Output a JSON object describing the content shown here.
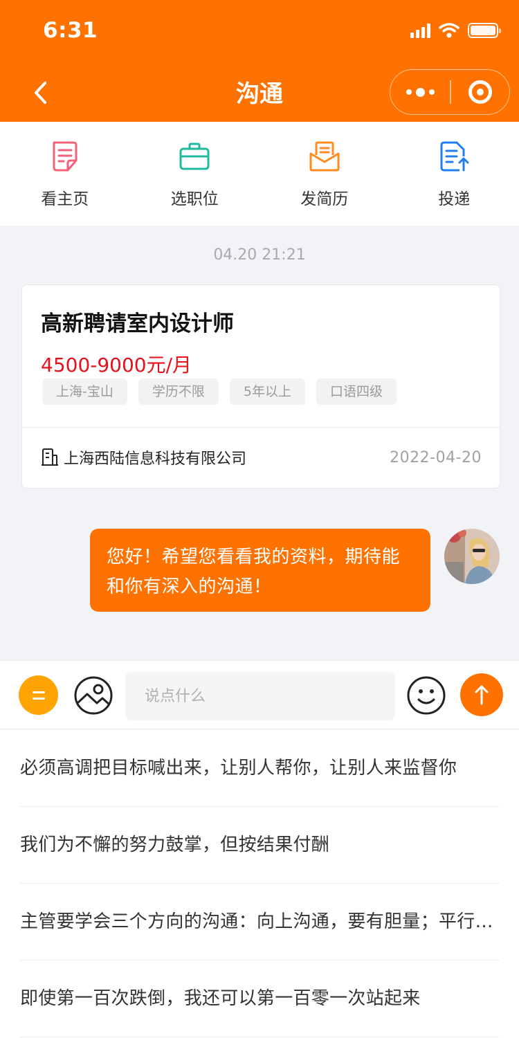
{
  "status_bar": {
    "time": "6:31"
  },
  "nav": {
    "title": "沟通"
  },
  "quick_actions": [
    {
      "label": "看主页",
      "icon": "resume-doc-icon"
    },
    {
      "label": "选职位",
      "icon": "briefcase-icon"
    },
    {
      "label": "发简历",
      "icon": "envelope-resume-icon"
    },
    {
      "label": "投递",
      "icon": "deliver-doc-icon"
    }
  ],
  "chat": {
    "timestamp": "04.20 21:21",
    "job_card": {
      "title": "高新聘请室内设计师",
      "salary": "4500-9000元/月",
      "tags": [
        "上海-宝山",
        "学历不限",
        "5年以上",
        "口语四级"
      ],
      "company": "上海西陆信息科技有限公司",
      "date": "2022-04-20"
    },
    "message": "您好！希望您看看我的资料，期待能和你有深入的沟通！"
  },
  "input": {
    "placeholder": "说点什么"
  },
  "phrases": [
    "必须高调把目标喊出来，让别人帮你，让别人来监督你",
    "我们为不懈的努力鼓掌，但按结果付酬",
    "主管要学会三个方向的沟通：向上沟通，要有胆量；平行沟通，要有肚量；向下沟通，要有心量",
    "即使第一百次跌倒，我还可以第一百零一次站起来"
  ],
  "colors": {
    "primary": "#ff7200",
    "salary": "#e8111b",
    "menu_button": "#ffa402"
  }
}
